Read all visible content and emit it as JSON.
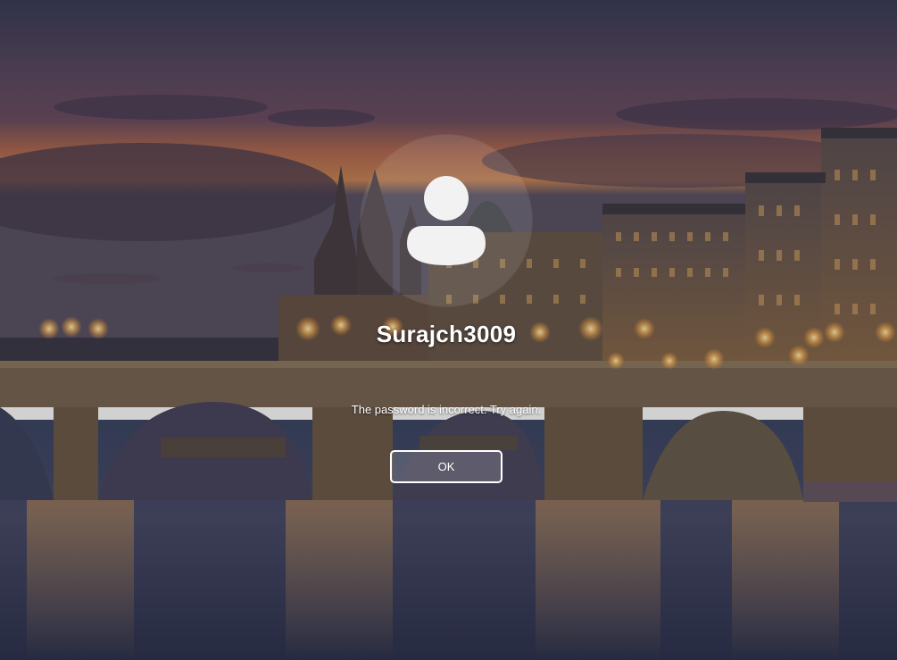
{
  "lock_screen": {
    "username": "Surajch3009",
    "error_message": "The password is incorrect. Try again.",
    "ok_button_label": "OK",
    "avatar_icon": "user-silhouette-icon"
  },
  "colors": {
    "text": "#ffffff",
    "button_border": "#ffffff",
    "sky_top": "#3a3d55",
    "sunset_glow": "#c77a4e",
    "river": "#3b4a6b",
    "lamp_glow": "#ffc56b"
  }
}
